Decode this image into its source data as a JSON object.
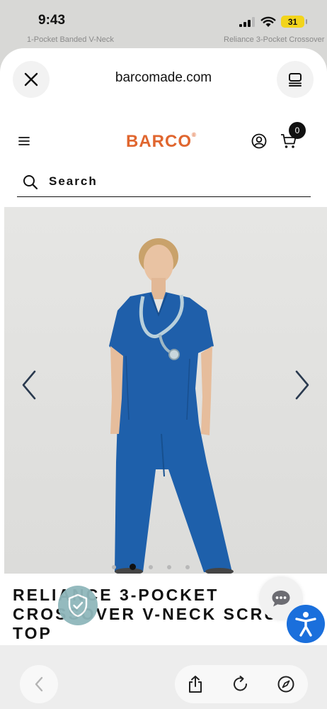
{
  "status_bar": {
    "time": "9:43",
    "battery": "31"
  },
  "background_page": {
    "item_1": "1-Pocket Banded V-Neck",
    "item_2": "Reliance 3-Pocket Crossover"
  },
  "browser": {
    "url": "barcomade.com",
    "close_icon": "close-icon",
    "reader_icon": "reader-icon"
  },
  "site": {
    "logo": "BARCO",
    "logo_mark": "®",
    "cart_count": "0",
    "brand_color": "#e0662f",
    "search_label": "Search"
  },
  "gallery": {
    "total_dots": 5,
    "active_index": 1,
    "prev_icon": "chevron-left-icon",
    "next_icon": "chevron-right-icon"
  },
  "product": {
    "title": "RELIANCE 3-POCKET CROSSOVER V-NECK SCRUB TOP",
    "scrub_color": "#1f5faa"
  },
  "overlays": {
    "shield_icon": "shield-check-icon",
    "chat_icon": "chat-bubble-icon",
    "accessibility_icon": "accessibility-icon",
    "accessibility_color": "#1a6fdc"
  },
  "toolbar": {
    "back_icon": "chevron-left-icon",
    "share_icon": "share-icon",
    "reload_icon": "reload-icon",
    "compass_icon": "compass-icon"
  }
}
